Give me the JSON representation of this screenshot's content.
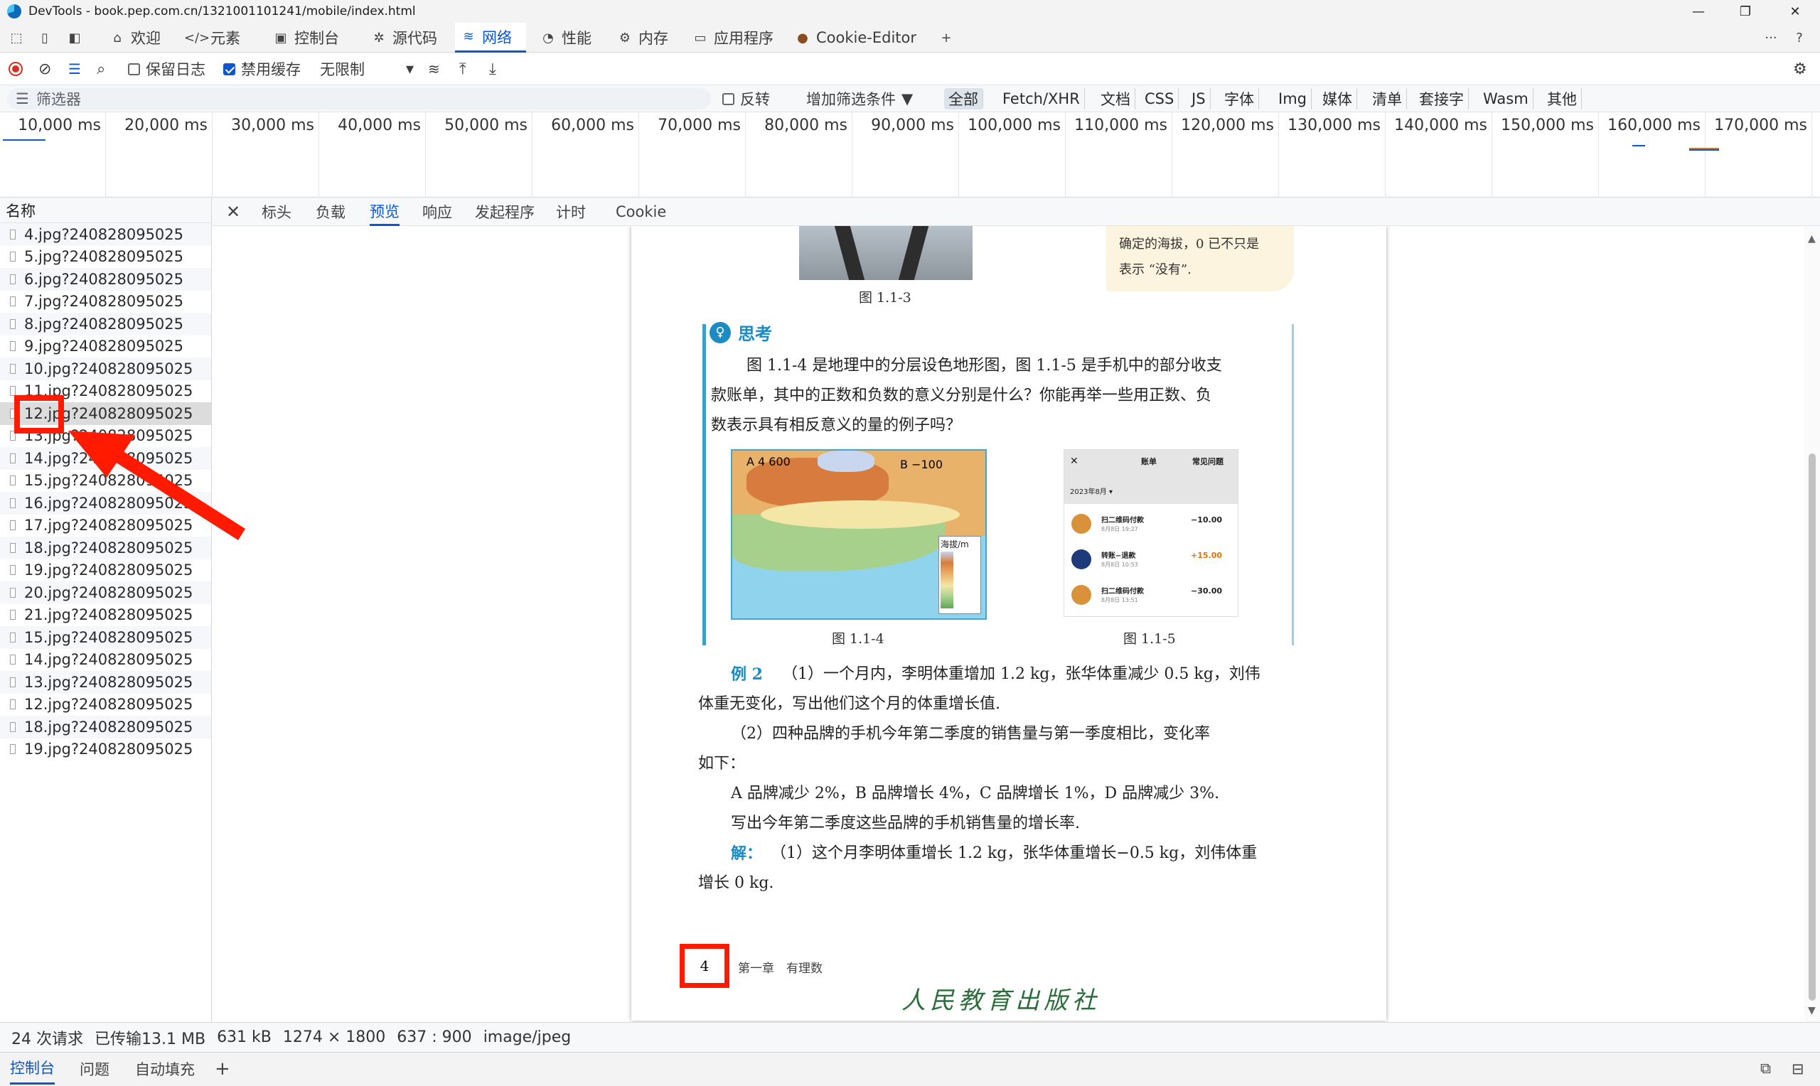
{
  "window": {
    "title": "DevTools - book.pep.com.cn/1321001101241/mobile/index.html",
    "minimize": "—",
    "restore": "❐",
    "close": "✕"
  },
  "tabs": [
    {
      "label": "欢迎",
      "icon": "home-icon",
      "glyph": "⌂"
    },
    {
      "label": "元素",
      "icon": "code-icon",
      "glyph": "</>"
    },
    {
      "label": "控制台",
      "icon": "console-icon",
      "glyph": "▣"
    },
    {
      "label": "源代码",
      "icon": "bug-icon",
      "glyph": "✲"
    },
    {
      "label": "网络",
      "icon": "wifi-icon",
      "glyph": "≋"
    },
    {
      "label": "性能",
      "icon": "performance-icon",
      "glyph": "◔"
    },
    {
      "label": "内存",
      "icon": "memory-icon",
      "glyph": "⚙"
    },
    {
      "label": "应用程序",
      "icon": "application-icon",
      "glyph": "▭"
    },
    {
      "label": "Cookie-Editor",
      "icon": "cookie-icon",
      "glyph": "●"
    }
  ],
  "tab_add": "+",
  "tab_more": "···",
  "tab_help": "?",
  "toolbar": {
    "preserve_log": "保留日志",
    "disable_cache": "禁用缓存",
    "throttle": "无限制",
    "dropdown_glyph": "▾"
  },
  "filter": {
    "placeholder": "筛选器",
    "invert": "反转",
    "more_filters": "增加筛选条件",
    "types": [
      "全部",
      "Fetch/XHR",
      "文档",
      "CSS",
      "JS",
      "字体",
      "Img",
      "媒体",
      "清单",
      "套接字",
      "Wasm",
      "其他"
    ]
  },
  "timeline": {
    "ticks": [
      "10,000 ms",
      "20,000 ms",
      "30,000 ms",
      "40,000 ms",
      "50,000 ms",
      "60,000 ms",
      "70,000 ms",
      "80,000 ms",
      "90,000 ms",
      "100,000 ms",
      "110,000 ms",
      "120,000 ms",
      "130,000 ms",
      "140,000 ms",
      "150,000 ms",
      "160,000 ms",
      "170,000 ms"
    ]
  },
  "request_list": {
    "header": "名称",
    "selected_index": 8,
    "rows": [
      "4.jpg?240828095025",
      "5.jpg?240828095025",
      "6.jpg?240828095025",
      "7.jpg?240828095025",
      "8.jpg?240828095025",
      "9.jpg?240828095025",
      "10.jpg?240828095025",
      "11.jpg?240828095025",
      "12.jpg?240828095025",
      "13.jpg?240828095025",
      "14.jpg?240828095025",
      "15.jpg?240828095025",
      "16.jpg?240828095025",
      "17.jpg?240828095025",
      "18.jpg?240828095025",
      "19.jpg?240828095025",
      "20.jpg?240828095025",
      "21.jpg?240828095025",
      "15.jpg?240828095025",
      "14.jpg?240828095025",
      "13.jpg?240828095025",
      "12.jpg?240828095025",
      "18.jpg?240828095025",
      "19.jpg?240828095025"
    ]
  },
  "detail_tabs": {
    "close": "✕",
    "items": [
      "标头",
      "负载",
      "预览",
      "响应",
      "发起程序",
      "计时",
      "Cookie"
    ],
    "active": "预览"
  },
  "page": {
    "note_line1": "确定的海拔，0 已不只是",
    "note_line2": "表示 “没有”.",
    "fig_113": "图 1.1-3",
    "think_title": "思考",
    "think_p1": "图 1.1-4 是地理中的分层设色地形图，图 1.1-5 是手机中的部分收支",
    "think_p2": "款账单，其中的正数和负数的意义分别是什么？你能再举一些用正数、负",
    "think_p3": "数表示具有相反意义的量的例子吗？",
    "map_a": "A 4 600",
    "map_b": "B −100",
    "map_legend": "海拔/m",
    "fig_114": "图 1.1-4",
    "fig_115": "图 1.1-5",
    "app_title": "账单",
    "app_faq": "常见问题",
    "app_month": "2023年8月 ▾",
    "app_rows": [
      {
        "name": "扫二维码付款",
        "time": "8月8日 19:27",
        "amount": "−10.00"
      },
      {
        "name": "转账−退款",
        "time": "8月8日 10:53",
        "amount": "+15.00"
      },
      {
        "name": "扫二维码付款",
        "time": "8月8日 13:51",
        "amount": "−30.00"
      }
    ],
    "ex2_label": "例 2",
    "ex2_l1": "（1）一个月内，李明体重增加 1.2 kg，张华体重减少 0.5 kg，刘伟",
    "ex2_l2": "体重无变化，写出他们这个月的体重增长值.",
    "ex2_l3": "（2）四种品牌的手机今年第二季度的销售量与第一季度相比，变化率",
    "ex2_l4": "如下：",
    "ex2_l5": "A 品牌减少 2%，B 品牌增长 4%，C 品牌增长 1%，D 品牌减少 3%.",
    "ex2_l6": "写出今年第二季度这些品牌的手机销售量的增长率.",
    "sol_label": "解：",
    "sol_l1": "（1）这个月李明体重增长 1.2 kg，张华体重增长−0.5 kg，刘伟体重",
    "sol_l2": "增长 0 kg.",
    "page_number": "4",
    "chapter": "第一章　有理数",
    "publisher": "人民教育出版社"
  },
  "status": {
    "requests": "24 次请求",
    "transferred": "已传输13.1 MB",
    "size": "631 kB",
    "dimensions": "1274 × 1800",
    "ratio": "637 : 900",
    "mime": "image/jpeg"
  },
  "drawer": {
    "tabs": [
      "控制台",
      "问题",
      "自动填充"
    ],
    "add": "+"
  },
  "colors": {
    "accent": "#0b57d0",
    "annotation": "#ff1a00"
  }
}
